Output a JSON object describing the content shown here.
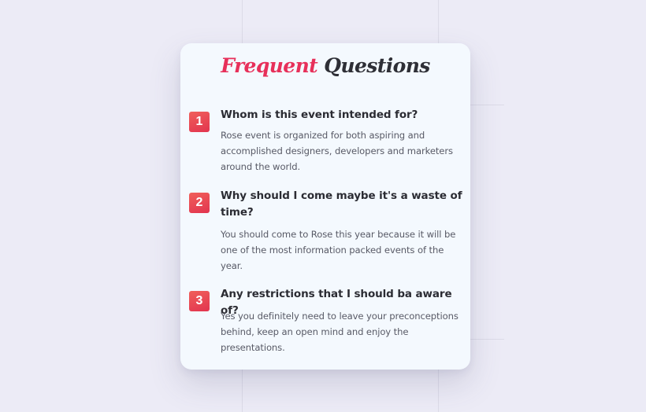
{
  "title": {
    "accent": "Frequent",
    "main": "Questions"
  },
  "faqs": [
    {
      "number": "1",
      "question": "Whom is this event intended for?",
      "answer": "Rose event is organized for both aspiring and accomplished designers, developers and marketers around the world."
    },
    {
      "number": "2",
      "question": "Why should I come maybe it's a waste of time?",
      "answer": "You should come to Rose this year because it will be one of the most information packed events of the year."
    },
    {
      "number": "3",
      "question": "Any restrictions that I should ba aware of?",
      "answer": "Yes you definitely need to leave your preconceptions behind, keep an open mind and enjoy the presentations."
    }
  ],
  "colors": {
    "background": "#ecebf6",
    "card": "#f4f9fe",
    "accent": "#e7305a",
    "badge": "#e93f53",
    "heading": "#2e2f36",
    "body_text": "#585a66"
  }
}
